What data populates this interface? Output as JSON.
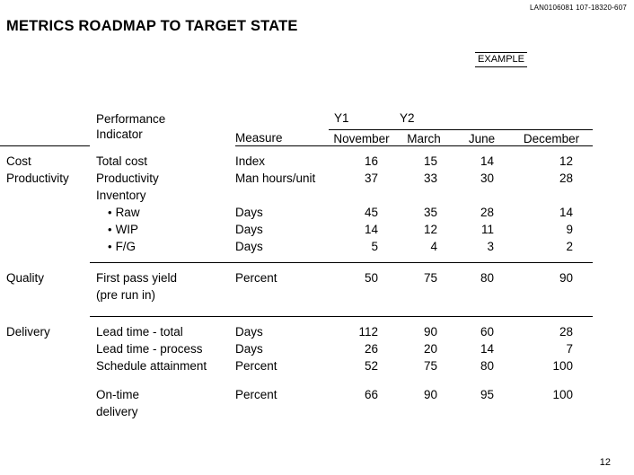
{
  "doc_code": "LAN0106081 107-18320-607",
  "title": "METRICS ROADMAP TO TARGET STATE",
  "example_stamp": "EXAMPLE",
  "page_number": "12",
  "table": {
    "header": {
      "indicator_line1": "Performance",
      "indicator_line2": "Indicator",
      "measure": "Measure",
      "year1": "Y1",
      "year2": "Y2",
      "months": [
        "November",
        "March",
        "June",
        "December"
      ]
    },
    "groups": [
      {
        "category": "Cost",
        "category_line2": "Productivity",
        "rows": [
          {
            "indicator": "Total cost",
            "measure": "Index",
            "values": [
              "16",
              "15",
              "14",
              "12"
            ]
          },
          {
            "indicator": "Productivity",
            "measure": "Man hours/unit",
            "values": [
              "37",
              "33",
              "30",
              "28"
            ]
          },
          {
            "indicator": "Inventory",
            "measure": "",
            "values": [
              "",
              "",
              "",
              ""
            ]
          },
          {
            "indicator": "Raw",
            "bullet": true,
            "measure": "Days",
            "values": [
              "45",
              "35",
              "28",
              "14"
            ]
          },
          {
            "indicator": "WIP",
            "bullet": true,
            "measure": "Days",
            "values": [
              "14",
              "12",
              "11",
              "9"
            ]
          },
          {
            "indicator": "F/G",
            "bullet": true,
            "measure": "Days",
            "values": [
              "5",
              "4",
              "3",
              "2"
            ]
          }
        ]
      },
      {
        "category": "Quality",
        "category_line2": "",
        "rows": [
          {
            "indicator": "First pass yield",
            "measure": "Percent",
            "values": [
              "50",
              "75",
              "80",
              "90"
            ]
          },
          {
            "indicator": "(pre run in)",
            "measure": "",
            "values": [
              "",
              "",
              "",
              ""
            ]
          }
        ]
      },
      {
        "category": "Delivery",
        "category_line2": "",
        "rows": [
          {
            "indicator": "Lead time - total",
            "measure": "Days",
            "values": [
              "112",
              "90",
              "60",
              "28"
            ]
          },
          {
            "indicator": "Lead time - process",
            "measure": "Days",
            "values": [
              "26",
              "20",
              "14",
              "7"
            ]
          },
          {
            "indicator": "Schedule attainment",
            "measure": "Percent",
            "values": [
              "52",
              "75",
              "80",
              "100"
            ]
          }
        ]
      },
      {
        "category": "",
        "category_line2": "",
        "rows": [
          {
            "indicator": "On-time",
            "measure": "Percent",
            "values": [
              "66",
              "90",
              "95",
              "100"
            ]
          },
          {
            "indicator": "delivery",
            "measure": "",
            "values": [
              "",
              "",
              "",
              ""
            ]
          }
        ]
      }
    ]
  },
  "chart_data": {
    "type": "table",
    "title": "METRICS ROADMAP TO TARGET STATE",
    "columns": [
      "Performance Indicator",
      "Measure",
      "Y1 November",
      "Y2 March",
      "Y2 June",
      "Y2 December"
    ],
    "rows": [
      {
        "category": "Cost Productivity",
        "indicator": "Total cost",
        "measure": "Index",
        "values": [
          16,
          15,
          14,
          12
        ]
      },
      {
        "category": "Cost Productivity",
        "indicator": "Productivity",
        "measure": "Man hours/unit",
        "values": [
          37,
          33,
          30,
          28
        ]
      },
      {
        "category": "Cost Productivity",
        "indicator": "Inventory - Raw",
        "measure": "Days",
        "values": [
          45,
          35,
          28,
          14
        ]
      },
      {
        "category": "Cost Productivity",
        "indicator": "Inventory - WIP",
        "measure": "Days",
        "values": [
          14,
          12,
          11,
          9
        ]
      },
      {
        "category": "Cost Productivity",
        "indicator": "Inventory - F/G",
        "measure": "Days",
        "values": [
          5,
          4,
          3,
          2
        ]
      },
      {
        "category": "Quality",
        "indicator": "First pass yield (pre run in)",
        "measure": "Percent",
        "values": [
          50,
          75,
          80,
          90
        ]
      },
      {
        "category": "Delivery",
        "indicator": "Lead time - total",
        "measure": "Days",
        "values": [
          112,
          90,
          60,
          28
        ]
      },
      {
        "category": "Delivery",
        "indicator": "Lead time - process",
        "measure": "Days",
        "values": [
          26,
          20,
          14,
          7
        ]
      },
      {
        "category": "Delivery",
        "indicator": "Schedule attainment",
        "measure": "Percent",
        "values": [
          52,
          75,
          80,
          100
        ]
      },
      {
        "category": "Delivery",
        "indicator": "On-time delivery",
        "measure": "Percent",
        "values": [
          66,
          90,
          95,
          100
        ]
      }
    ]
  }
}
